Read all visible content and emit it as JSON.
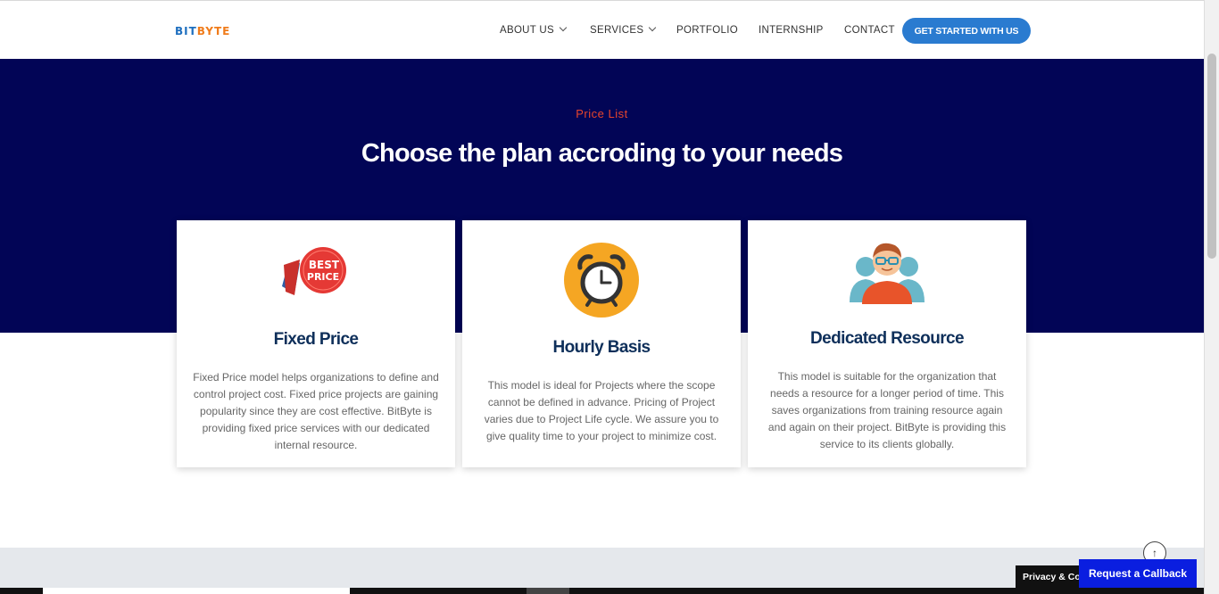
{
  "header": {
    "logo": {
      "part1": "BIT",
      "part2": "BYTE"
    },
    "nav": [
      {
        "label": "ABOUT US",
        "has_dropdown": true
      },
      {
        "label": "SERVICES",
        "has_dropdown": true
      },
      {
        "label": "PORTFOLIO",
        "has_dropdown": false
      },
      {
        "label": "INTERNSHIP",
        "has_dropdown": false
      },
      {
        "label": "CONTACT",
        "has_dropdown": false
      }
    ],
    "cta_label": "GET STARTED WITH US"
  },
  "pricing": {
    "eyebrow": "Price List",
    "headline": "Choose the plan accroding to your needs",
    "cards": [
      {
        "icon": "best-price-badge-icon",
        "badge_text_1": "BEST",
        "badge_text_2": "PRICE",
        "title": "Fixed Price",
        "description": "Fixed Price model helps organizations to define and control project cost. Fixed price projects are gaining popularity since they are cost effective. BitByte is providing fixed price services with our dedicated internal resource."
      },
      {
        "icon": "alarm-clock-icon",
        "title": "Hourly Basis",
        "description": "This model is ideal for Projects where the scope cannot be defined in advance. Pricing of Project varies due to Project Life cycle. We assure you to give quality time to your project to minimize cost."
      },
      {
        "icon": "team-people-icon",
        "title": "Dedicated Resource",
        "description": "This model is suitable for the organization that needs a resource for a longer period of time. This saves organizations from training resource again and again on their project. BitByte is providing this service to its clients globally."
      }
    ]
  },
  "widgets": {
    "privacy_label": "Privacy & Cookies",
    "callback_label": "Request a Callback",
    "scroll_top_icon": "arrow-up-icon"
  },
  "colors": {
    "band": "#020556",
    "accent": "#e8452c",
    "cta": "#2a7bd0",
    "callback": "#0a1ee0"
  }
}
